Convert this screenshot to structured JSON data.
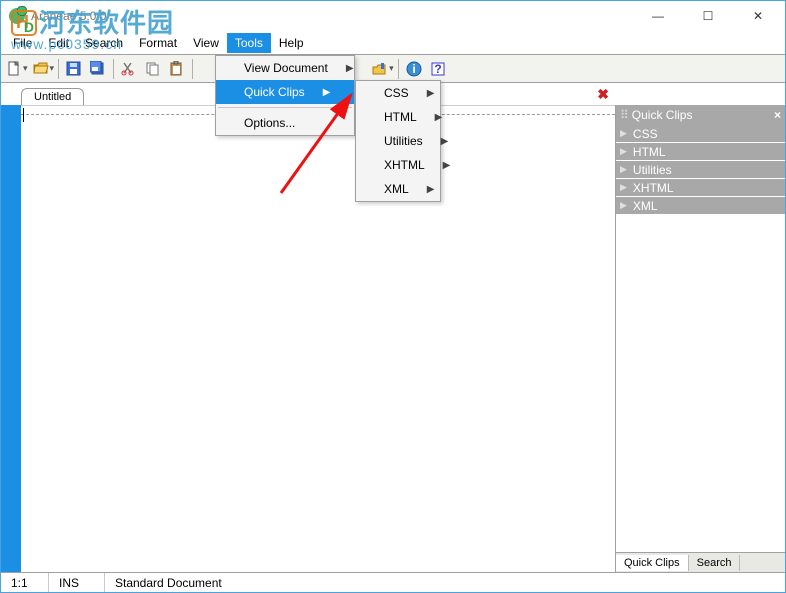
{
  "window": {
    "title": "Araneae 5.0.0",
    "controls": {
      "min": "—",
      "max": "☐",
      "close": "✕"
    }
  },
  "menubar": [
    "File",
    "Edit",
    "Search",
    "Format",
    "View",
    "Tools",
    "Help"
  ],
  "menubar_active_index": 5,
  "tools_menu": {
    "view_document": "View Document",
    "quick_clips": "Quick Clips",
    "options": "Options..."
  },
  "quick_clips_submenu": [
    "CSS",
    "HTML",
    "Utilities",
    "XHTML",
    "XML"
  ],
  "tabs": {
    "current": "Untitled"
  },
  "side_panel": {
    "title": "Quick Clips",
    "items": [
      "CSS",
      "HTML",
      "Utilities",
      "XHTML",
      "XML"
    ],
    "footer_tabs": [
      "Quick Clips",
      "Search"
    ],
    "footer_active": 0
  },
  "statusbar": {
    "pos": "1:1",
    "mode": "INS",
    "doc": "Standard Document"
  },
  "watermark": {
    "cn": "河东软件园",
    "url": "www.pc0359.cn"
  }
}
